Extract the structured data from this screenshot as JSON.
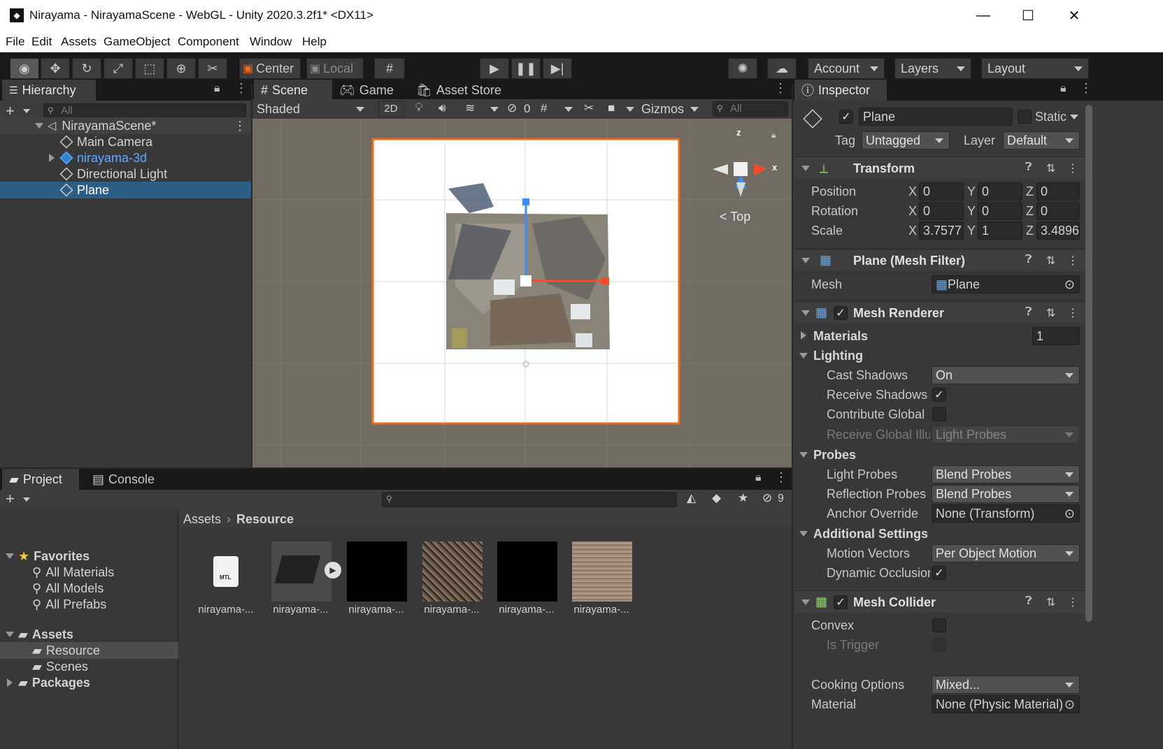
{
  "window": {
    "title": "Nirayama - NirayamaScene - WebGL - Unity 2020.3.2f1* <DX11>"
  },
  "menu": [
    "File",
    "Edit",
    "Assets",
    "GameObject",
    "Component",
    "Window",
    "Help"
  ],
  "toolbar": {
    "center_label": "Center",
    "local_label": "Local",
    "account_label": "Account",
    "layers_label": "Layers",
    "layout_label": "Layout"
  },
  "hierarchy": {
    "tab": "Hierarchy",
    "search_placeholder": "All",
    "scene": "NirayamaScene*",
    "items": [
      {
        "label": "Main Camera"
      },
      {
        "label": "nirayama-3d"
      },
      {
        "label": "Directional Light"
      },
      {
        "label": "Plane"
      }
    ]
  },
  "scene_view": {
    "tabs": [
      "Scene",
      "Game",
      "Asset Store"
    ],
    "shading": "Shaded",
    "mode_2d": "2D",
    "hidden_count": "0",
    "gizmos": "Gizmos",
    "search_placeholder": "All",
    "view_label": "Top",
    "axis_z": "z",
    "axis_x": "x"
  },
  "project": {
    "tabs": [
      "Project",
      "Console"
    ],
    "hidden_count": "9",
    "favorites_label": "Favorites",
    "favorites": [
      "All Materials",
      "All Models",
      "All Prefabs"
    ],
    "assets_label": "Assets",
    "assets_children": [
      "Resource",
      "Scenes"
    ],
    "packages_label": "Packages",
    "breadcrumb": [
      "Assets",
      "Resource"
    ],
    "files": [
      "nirayama-...",
      "nirayama-...",
      "nirayama-...",
      "nirayama-...",
      "nirayama-...",
      "nirayama-..."
    ],
    "mtl_label": "MTL"
  },
  "inspector": {
    "tab": "Inspector",
    "object_name": "Plane",
    "static_label": "Static",
    "tag_label": "Tag",
    "tag_value": "Untagged",
    "layer_label": "Layer",
    "layer_value": "Default",
    "transform": {
      "title": "Transform",
      "position_label": "Position",
      "rotation_label": "Rotation",
      "scale_label": "Scale",
      "x": "X",
      "y": "Y",
      "z": "Z",
      "position": [
        "0",
        "0",
        "0"
      ],
      "rotation": [
        "0",
        "0",
        "0"
      ],
      "scale": [
        "3.7577",
        "1",
        "3.4896"
      ]
    },
    "mesh_filter": {
      "title": "Plane (Mesh Filter)",
      "mesh_label": "Mesh",
      "mesh_value": "Plane"
    },
    "mesh_renderer": {
      "title": "Mesh Renderer",
      "materials_label": "Materials",
      "materials_count": "1",
      "lighting_label": "Lighting",
      "cast_shadows_label": "Cast Shadows",
      "cast_shadows_value": "On",
      "receive_shadows_label": "Receive Shadows",
      "contribute_gi_label": "Contribute Global",
      "receive_gi_label": "Receive Global Illu",
      "receive_gi_value": "Light Probes",
      "probes_label": "Probes",
      "light_probes_label": "Light Probes",
      "light_probes_value": "Blend Probes",
      "reflection_probes_label": "Reflection Probes",
      "reflection_probes_value": "Blend Probes",
      "anchor_override_label": "Anchor Override",
      "anchor_override_value": "None (Transform)",
      "additional_label": "Additional Settings",
      "motion_vectors_label": "Motion Vectors",
      "motion_vectors_value": "Per Object Motion",
      "dynamic_occlusion_label": "Dynamic Occlusion"
    },
    "mesh_collider": {
      "title": "Mesh Collider",
      "convex_label": "Convex",
      "is_trigger_label": "Is Trigger",
      "cooking_label": "Cooking Options",
      "cooking_value": "Mixed...",
      "material_label": "Material",
      "material_value": "None (Physic Material)"
    }
  },
  "colors": {
    "selection": "#2c5d87",
    "accent_orange": "#f06a1c",
    "axis_blue": "#3b8cff",
    "axis_red": "#ff4a2a",
    "scene_bg": "#726b62"
  }
}
